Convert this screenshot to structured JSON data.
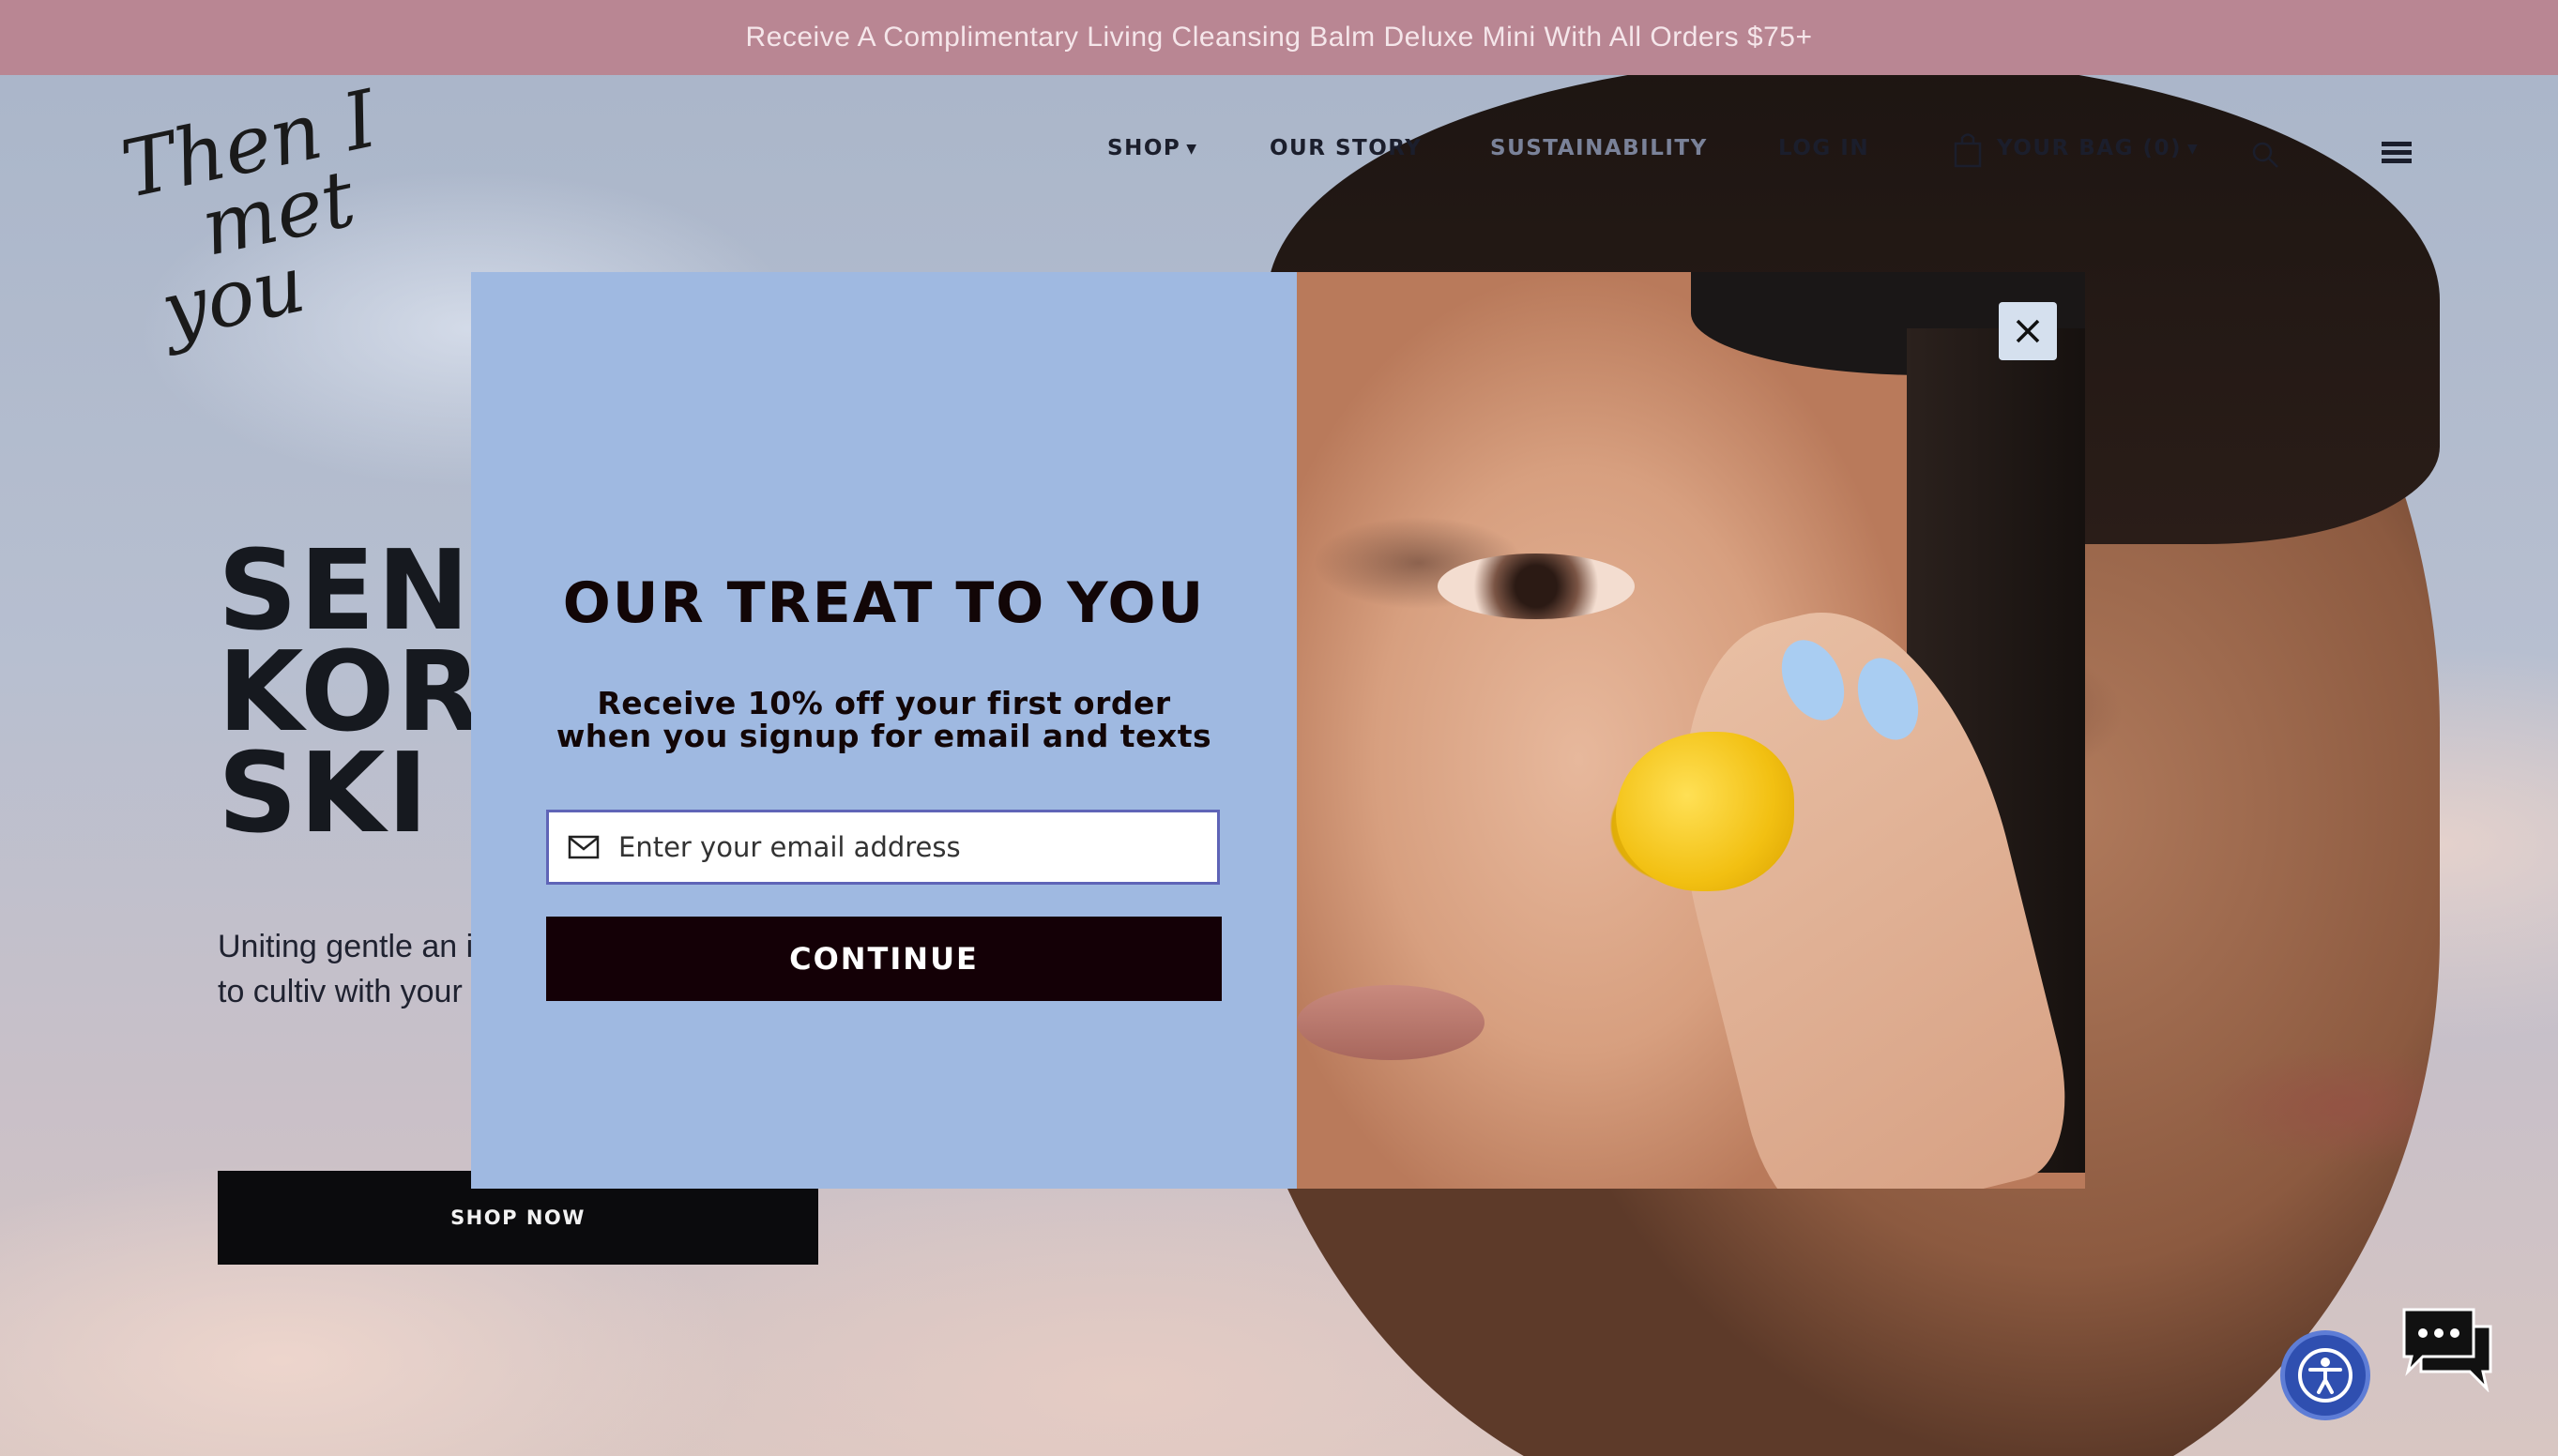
{
  "promo_bar": {
    "text": "Receive A Complimentary Living Cleansing Balm Deluxe Mini With All Orders $75+"
  },
  "logo": {
    "line1": "Then I",
    "line2": "met",
    "line3": "you"
  },
  "nav": {
    "shop": "SHOP",
    "our_story": "OUR STORY",
    "sustainability": "SUSTAINABILITY",
    "log_in": "LOG IN",
    "bag": "YOUR BAG (0)"
  },
  "hero": {
    "title_line1": "SEN",
    "title_line2": "KOR",
    "title_line3": "SKI",
    "description": "Uniting gentle an ingredients with e designed to cultiv with your skin.",
    "cta": "SHOP NOW"
  },
  "modal": {
    "title": "OUR TREAT TO YOU",
    "subtitle": "Receive 10% off your first order when you signup for email and texts",
    "email_placeholder": "Enter your email address",
    "continue_label": "CONTINUE"
  },
  "colors": {
    "promo_bar": "#b98693",
    "modal_panel": "#9fb9e1",
    "continue_button": "#140006",
    "input_border": "#5f64b7"
  },
  "icons": [
    "caret-down-icon",
    "shopping-bag-icon",
    "search-icon",
    "hamburger-menu-icon",
    "close-icon",
    "mail-icon",
    "accessibility-icon",
    "chat-icon"
  ]
}
